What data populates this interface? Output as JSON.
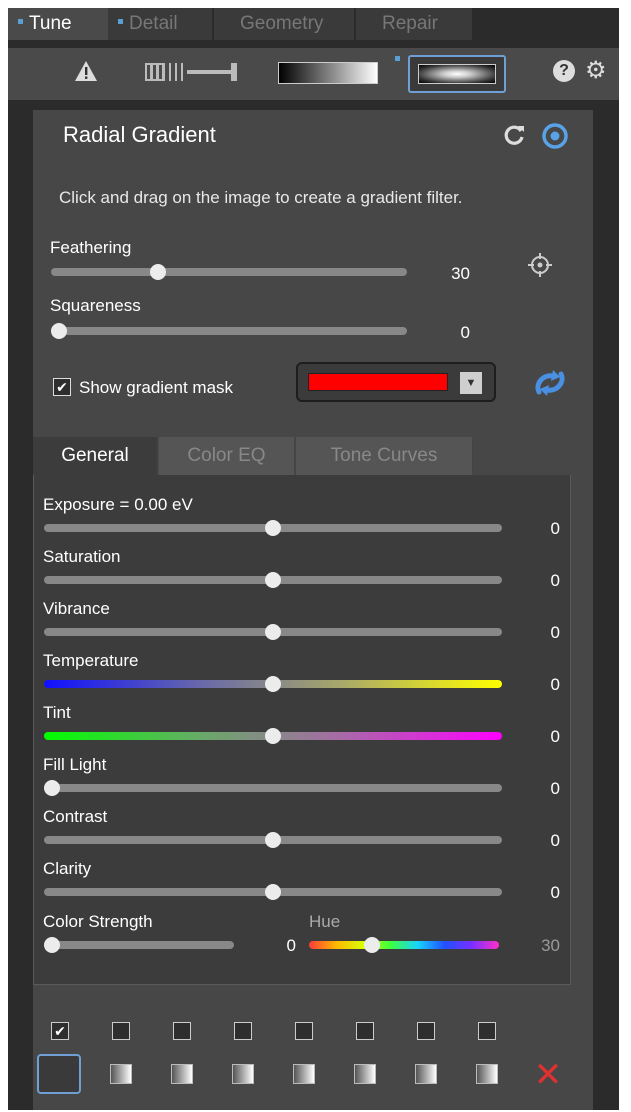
{
  "top_tabs": [
    {
      "label": "Tune",
      "active": true
    },
    {
      "label": "Detail",
      "active": false
    },
    {
      "label": "Geometry",
      "active": false
    },
    {
      "label": "Repair",
      "active": false
    }
  ],
  "toolbar": {
    "icons": [
      "warning-icon",
      "split-view-icon",
      "graduated-filter-icon",
      "radial-filter-icon",
      "help-icon",
      "settings-icon"
    ],
    "help_glyph": "?",
    "settings_glyph": "⚙"
  },
  "panel": {
    "title": "Radial Gradient",
    "instruction": "Click and drag on the image to create a gradient filter.",
    "feathering": {
      "label": "Feathering",
      "value": "30",
      "fraction": 0.3
    },
    "squareness": {
      "label": "Squareness",
      "value": "0",
      "fraction": 0
    },
    "show_mask": {
      "label": "Show gradient mask",
      "checked": true,
      "check_glyph": "✔"
    },
    "mask_color": "#ff0000",
    "dropdown_glyph": "▼"
  },
  "sub_tabs": [
    {
      "label": "General",
      "active": true
    },
    {
      "label": "Color EQ",
      "active": false
    },
    {
      "label": "Tone Curves",
      "active": false
    }
  ],
  "adjustments": [
    {
      "label": "Exposure = 0.00 eV",
      "value": "0",
      "fraction": 0.5
    },
    {
      "label": "Saturation",
      "value": "0",
      "fraction": 0.5
    },
    {
      "label": "Vibrance",
      "value": "0",
      "fraction": 0.5
    },
    {
      "label": "Temperature",
      "value": "0",
      "fraction": 0.5
    },
    {
      "label": "Tint",
      "value": "0",
      "fraction": 0.5
    },
    {
      "label": "Fill Light",
      "value": "0",
      "fraction": 0
    },
    {
      "label": "Contrast",
      "value": "0",
      "fraction": 0.5
    },
    {
      "label": "Clarity",
      "value": "0",
      "fraction": 0.5
    }
  ],
  "color_strength": {
    "label": "Color Strength",
    "value": "0",
    "fraction": 0
  },
  "hue": {
    "label": "Hue",
    "value": "30",
    "fraction": 0.33
  },
  "presets": {
    "checks": [
      true,
      false,
      false,
      false,
      false,
      false,
      false,
      false
    ],
    "check_glyph": "✔",
    "delete_glyph": "✕"
  }
}
